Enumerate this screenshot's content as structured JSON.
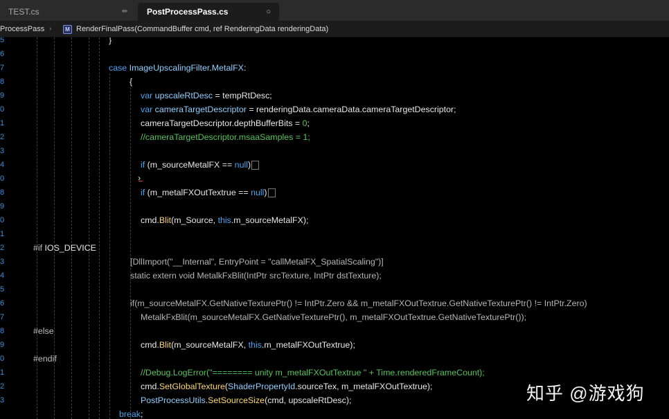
{
  "tabs": [
    {
      "label": "TEST.cs",
      "icon": "pin-icon",
      "icon_glyph": "⇹",
      "active": false
    },
    {
      "label": "PostProcessPass.cs",
      "icon": "close-icon",
      "icon_glyph": "○",
      "active": true
    }
  ],
  "breadcrumb": {
    "class_name": "ProcessPass",
    "separator": "›",
    "method_icon": "M",
    "method": "RenderFinalPass(CommandBuffer cmd, ref RenderingData renderingData)"
  },
  "line_numbers": [
    "5",
    "6",
    "7",
    "8",
    "9",
    "0",
    "1",
    "2",
    "3",
    "4",
    "0",
    "8",
    "9",
    "0",
    "1",
    "2",
    "3",
    "4",
    "5",
    "6",
    "7",
    "8",
    "9",
    "0",
    "1",
    "2",
    "3"
  ],
  "code": {
    "l01": "}",
    "l03_kw": "case",
    "l03_type": "ImageUpscalingFilter",
    "l03_dot": ".",
    "l03_member": "MetalFX",
    "l03_colon": ":",
    "l04": "{",
    "l05_kw": "var",
    "l05_var": "upscaleRtDesc",
    "l05_rest": " = tempRtDesc;",
    "l06_kw": "var",
    "l06_var": "cameraTargetDescriptor",
    "l06_rest": " = renderingData.cameraData.cameraTargetDescriptor;",
    "l07_a": "cameraTargetDescriptor.depthBufferBits = ",
    "l07_num": "0",
    "l07_b": ";",
    "l08": "//cameraTargetDescriptor.msaaSamples = 1;",
    "l10_kw": "if",
    "l10_a": " (m_sourceMetalFX == ",
    "l10_null": "null",
    "l10_b": ")",
    "l11": "›",
    "l12_kw": "if",
    "l12_a": " (m_metalFXOutTextrue == ",
    "l12_null": "null",
    "l12_b": ")",
    "l14_a": "cmd.",
    "l14_fn": "Blit",
    "l14_b": "(m_Source, ",
    "l14_this": "this",
    "l14_c": ".m_sourceMetalFX);",
    "l16_pp": "#if",
    "l16_sym": "IOS_DEVICE",
    "l17": "[DllImport(\"__Internal\", EntryPoint = \"callMetalFX_SpatialScaling\")]",
    "l18": "static extern void MetalkFxBlit(IntPtr srcTexture, IntPtr dstTexture);",
    "l20": "if(m_sourceMetalFX.GetNativeTexturePtr() != IntPtr.Zero && m_metalFXOutTextrue.GetNativeTexturePtr() != IntPtr.Zero)",
    "l21": "MetalkFxBlit(m_sourceMetalFX.GetNativeTexturePtr(), m_metalFXOutTextrue.GetNativeTexturePtr());",
    "l22_pp": "#else",
    "l23_a": "cmd.",
    "l23_fn": "Blit",
    "l23_b": "(m_sourceMetalFX, ",
    "l23_this": "this",
    "l23_c": ".m_metalFXOutTextrue);",
    "l24_pp": "#endif",
    "l25": "//Debug.LogError(\"======== unity m_metalFXOutTextrue   \" + Time.renderedFrameCount);",
    "l26_a": "cmd.",
    "l26_fn": "SetGlobalTexture",
    "l26_b": "(",
    "l26_type": "ShaderPropertyId",
    "l26_c": ".sourceTex, m_metalFXOutTextrue);",
    "l27_type": "PostProcessUtils",
    "l27_dot": ".",
    "l27_fn": "SetSourceSize",
    "l27_rest": "(cmd, upscaleRtDesc);",
    "l28_kw": "break",
    "l28_rest": ";"
  },
  "watermark": "知乎 @游戏狗",
  "colors": {
    "keyword": "#4aa3ee",
    "type": "#8fd0ff",
    "method": "#ffd86b",
    "comment": "#58c35a",
    "line_number": "#3f8fd8"
  }
}
